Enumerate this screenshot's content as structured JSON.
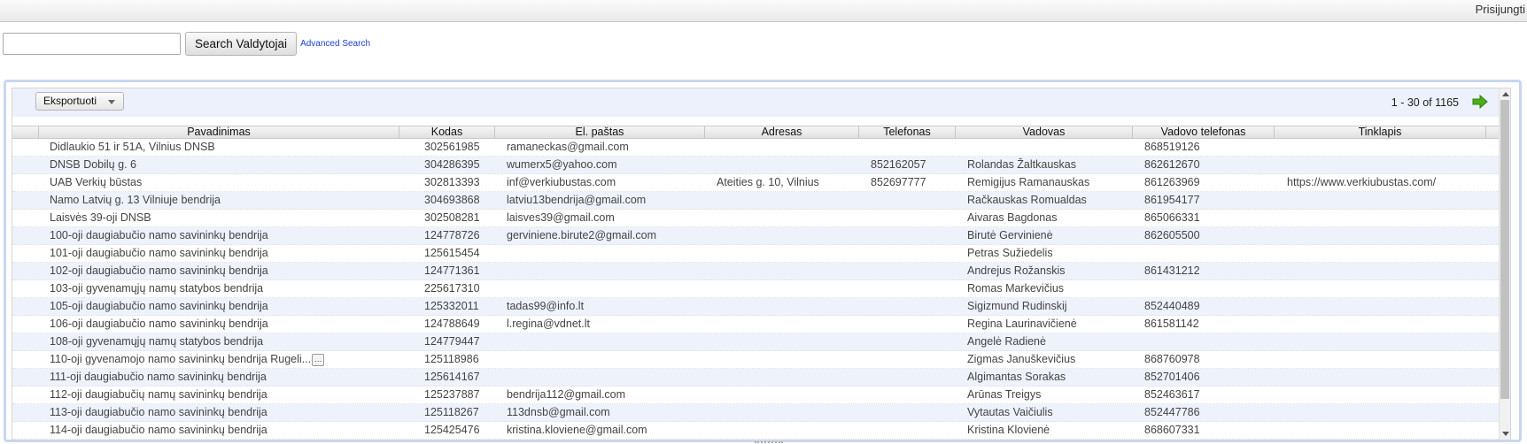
{
  "header": {
    "login_label": "Prisijungti"
  },
  "search": {
    "placeholder": "",
    "value": "",
    "button_label": "Search Valdytojai",
    "advanced_label": "Advanced Search"
  },
  "grid": {
    "export_label": "Eksportuoti",
    "pager_text": "1 - 30 of 1165",
    "columns": [
      "",
      "Pavadinimas",
      "Kodas",
      "El. paštas",
      "Adresas",
      "Telefonas",
      "Vadovas",
      "Vadovo telefonas",
      "Tinklapis"
    ],
    "rows": [
      [
        "Didlaukio 51 ir 51A, Vilnius DNSB",
        "302561985",
        "ramaneckas@gmail.com",
        "",
        "",
        "",
        "868519126",
        ""
      ],
      [
        "DNSB Dobilų g. 6",
        "304286395",
        "wumerx5@yahoo.com",
        "",
        "852162057",
        "Rolandas Žaltkauskas",
        "862612670",
        ""
      ],
      [
        "UAB Verkių būstas",
        "302813393",
        "inf@verkiubustas.com",
        "Ateities g. 10, Vilnius",
        "852697777",
        "Remigijus Ramanauskas",
        "861263969",
        "https://www.verkiubustas.com/"
      ],
      [
        "Namo Latvių g. 13 Vilniuje bendrija",
        "304693868",
        "latviu13bendrija@gmail.com",
        "",
        "",
        "Račkauskas Romualdas",
        "861954177",
        ""
      ],
      [
        "Laisvės 39-oji DNSB",
        "302508281",
        "laisves39@gmail.com",
        "",
        "",
        "Aivaras Bagdonas",
        "865066331",
        ""
      ],
      [
        "100-oji daugiabučio namo savininkų bendrija",
        "124778726",
        "gerviniene.birute2@gmail.com",
        "",
        "",
        "Birutė Gervinienė",
        "862605500",
        ""
      ],
      [
        "101-oji daugiabučio namo savininkų bendrija",
        "125615454",
        "",
        "",
        "",
        "Petras Sužiedelis",
        "",
        ""
      ],
      [
        "102-oji daugiabučio namo savininkų bendrija",
        "124771361",
        "",
        "",
        "",
        "Andrejus Rožanskis",
        "861431212",
        ""
      ],
      [
        "103-oji gyvenamųjų namų statybos bendrija",
        "225617310",
        "",
        "",
        "",
        "Romas Markevičius",
        "",
        ""
      ],
      [
        "105-oji daugiabučio namo savininkų bendrija",
        "125332011",
        "tadas99@info.lt",
        "",
        "",
        "Sigizmund Rudinskij",
        "852440489",
        ""
      ],
      [
        "106-oji daugiabučio namo savininkų bendrija",
        "124788649",
        "l.regina@vdnet.lt",
        "",
        "",
        "Regina Laurinavičienė",
        "861581142",
        ""
      ],
      [
        "108-oji gyvenamųjų namų statybos bendrija",
        "124779447",
        "",
        "",
        "",
        "Angelė Radienė",
        "",
        ""
      ],
      [
        "110-oji gyvenamojo namo savininkų bendrija Rugeli...",
        "125118986",
        "",
        "",
        "",
        "Zigmas Januškevičius",
        "868760978",
        ""
      ],
      [
        "111-oji daugiabučio namo savininkų bendrija",
        "125614167",
        "",
        "",
        "",
        "Algimantas Sorakas",
        "852701406",
        ""
      ],
      [
        "112-oji daugiabučių namų savininkų bendrija",
        "125237887",
        "bendrija112@gmail.com",
        "",
        "",
        "Arūnas Treigys",
        "852463617",
        ""
      ],
      [
        "113-oji daugiabučio namo savininkų bendrija",
        "125118267",
        "113dnsb@gmail.com",
        "",
        "",
        "Vytautas Vaičiulis",
        "852447786",
        ""
      ],
      [
        "114-oji daugiabučio namo savininkų bendrija",
        "125425476",
        "kristina.kloviene@gmail.com",
        "",
        "",
        "Kristina Klovienė",
        "868607331",
        ""
      ]
    ]
  },
  "icons": {
    "next": "arrow-right-icon",
    "export_caret": "chevron-down-icon"
  },
  "colors": {
    "accent_border": "#c8d6f3",
    "row_alt": "#eef2fb",
    "next_arrow": "#4caf1a"
  }
}
